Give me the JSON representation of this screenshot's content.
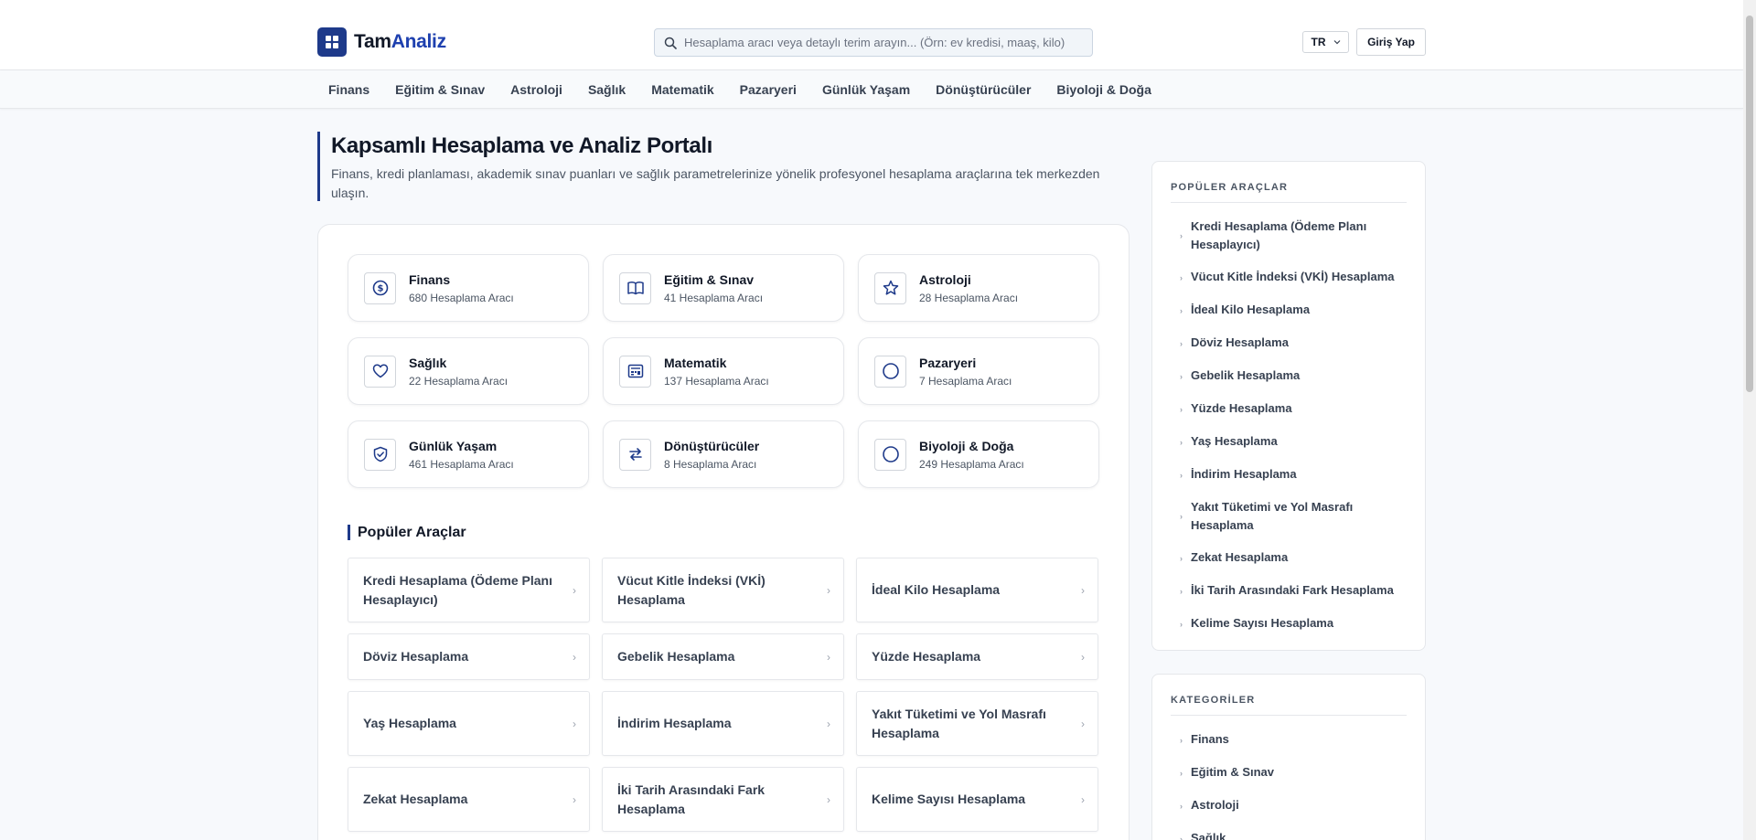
{
  "header": {
    "logo_part1": "Tam",
    "logo_part2": "Analiz",
    "search_placeholder": "Hesaplama aracı veya detaylı terim arayın... (Örn: ev kredisi, maaş, kilo)",
    "lang": "TR",
    "login": "Giriş Yap"
  },
  "nav": [
    "Finans",
    "Eğitim & Sınav",
    "Astroloji",
    "Sağlık",
    "Matematik",
    "Pazaryeri",
    "Günlük Yaşam",
    "Dönüştürücüler",
    "Biyoloji & Doğa"
  ],
  "hero": {
    "title": "Kapsamlı Hesaplama ve Analiz Portalı",
    "subtitle": "Finans, kredi planlaması, akademik sınav puanları ve sağlık parametrelerinize yönelik profesyonel hesaplama araçlarına tek merkezden ulaşın."
  },
  "categories": [
    {
      "name": "Finans",
      "count": "680 Hesaplama Aracı",
      "icon": "dollar-icon"
    },
    {
      "name": "Eğitim & Sınav",
      "count": "41 Hesaplama Aracı",
      "icon": "book-icon"
    },
    {
      "name": "Astroloji",
      "count": "28 Hesaplama Aracı",
      "icon": "star-icon"
    },
    {
      "name": "Sağlık",
      "count": "22 Hesaplama Aracı",
      "icon": "heart-icon"
    },
    {
      "name": "Matematik",
      "count": "137 Hesaplama Aracı",
      "icon": "calculator-icon"
    },
    {
      "name": "Pazaryeri",
      "count": "7 Hesaplama Aracı",
      "icon": "circle-icon"
    },
    {
      "name": "Günlük Yaşam",
      "count": "461 Hesaplama Aracı",
      "icon": "shield-check-icon"
    },
    {
      "name": "Dönüştürücüler",
      "count": "8 Hesaplama Aracı",
      "icon": "swap-icon"
    },
    {
      "name": "Biyoloji & Doğa",
      "count": "249 Hesaplama Aracı",
      "icon": "circle-icon"
    }
  ],
  "popular_title": "Popüler Araçlar",
  "tools": [
    "Kredi Hesaplama (Ödeme Planı Hesaplayıcı)",
    "Vücut Kitle İndeksi (VKİ) Hesaplama",
    "İdeal Kilo Hesaplama",
    "Döviz Hesaplama",
    "Gebelik Hesaplama",
    "Yüzde Hesaplama",
    "Yaş Hesaplama",
    "İndirim Hesaplama",
    "Yakıt Tüketimi ve Yol Masrafı Hesaplama",
    "Zekat Hesaplama",
    "İki Tarih Arasındaki Fark Hesaplama",
    "Kelime Sayısı Hesaplama"
  ],
  "sidebar": {
    "popular_heading": "POPÜLER ARAÇLAR",
    "categories_heading": "KATEGORİLER",
    "categories": [
      "Finans",
      "Eğitim & Sınav",
      "Astroloji",
      "Sağlık"
    ]
  },
  "colors": {
    "brand": "#1e3a8a",
    "accent_text": "#1e40af"
  }
}
